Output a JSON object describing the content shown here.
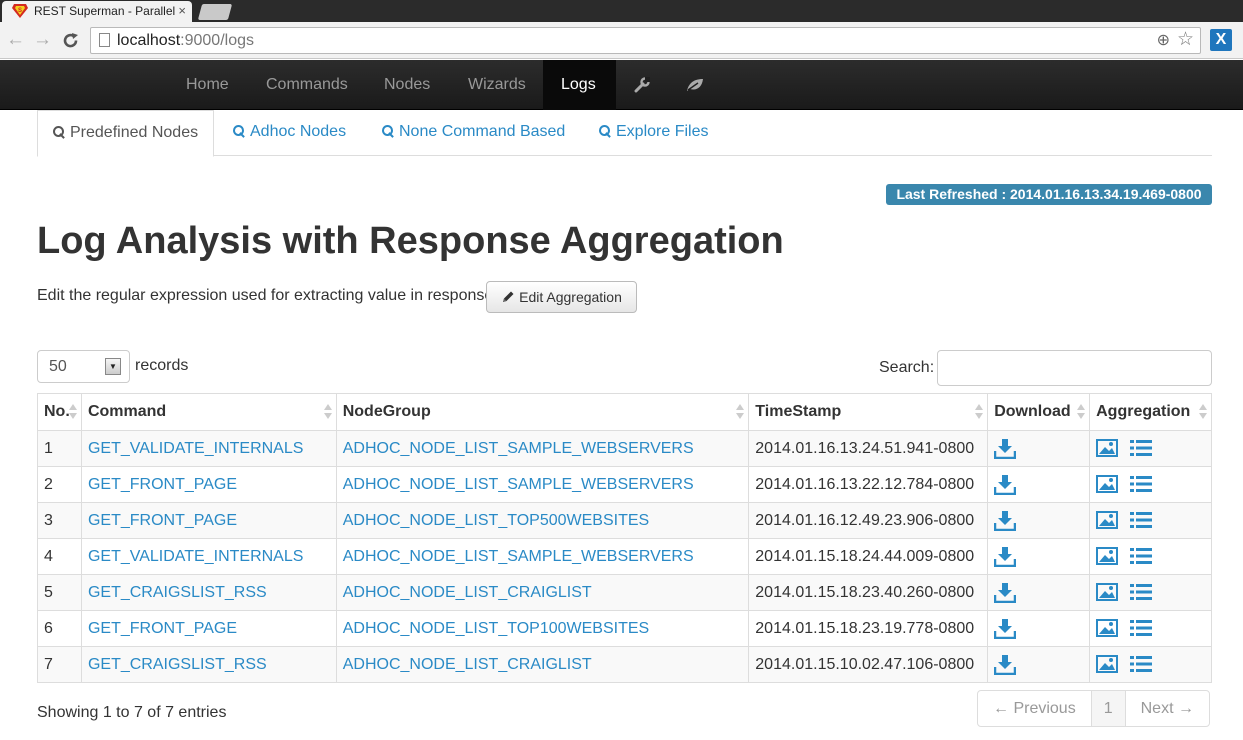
{
  "browser": {
    "tab_title": "REST Superman - Parallel",
    "tab_close": "×",
    "url_host": "localhost",
    "url_path": ":9000/logs",
    "back_glyph": "←",
    "forward_glyph": "→",
    "reload_glyph": "C",
    "zoom_glyph": "⊕",
    "star_glyph": "☆",
    "extension_label": "X"
  },
  "navbar": {
    "items": [
      {
        "label": "Home"
      },
      {
        "label": "Commands"
      },
      {
        "label": "Nodes"
      },
      {
        "label": "Wizards"
      },
      {
        "label": "Logs",
        "active": true
      }
    ],
    "icons": [
      "wrench-icon",
      "leaf-icon"
    ]
  },
  "subtabs": [
    {
      "label": "Predefined Nodes",
      "active": true
    },
    {
      "label": "Adhoc Nodes"
    },
    {
      "label": "None Command Based"
    },
    {
      "label": "Explore Files"
    }
  ],
  "last_refreshed": "Last Refreshed : 2014.01.16.13.34.19.469-0800",
  "page_title": "Log Analysis with Response Aggregation",
  "edit_text": "Edit the regular expression used for extracting value in response:",
  "edit_button_label": "Edit Aggregation",
  "table_controls": {
    "page_length": "50",
    "records_label": "records",
    "search_label": "Search:",
    "search_value": ""
  },
  "table": {
    "columns": [
      "No.",
      "Command",
      "NodeGroup",
      "TimeStamp",
      "Download",
      "Aggregation"
    ],
    "rows": [
      {
        "no": "1",
        "command": "GET_VALIDATE_INTERNALS",
        "nodegroup": "ADHOC_NODE_LIST_SAMPLE_WEBSERVERS",
        "timestamp": "2014.01.16.13.24.51.941-0800"
      },
      {
        "no": "2",
        "command": "GET_FRONT_PAGE",
        "nodegroup": "ADHOC_NODE_LIST_SAMPLE_WEBSERVERS",
        "timestamp": "2014.01.16.13.22.12.784-0800"
      },
      {
        "no": "3",
        "command": "GET_FRONT_PAGE",
        "nodegroup": "ADHOC_NODE_LIST_TOP500WEBSITES",
        "timestamp": "2014.01.16.12.49.23.906-0800"
      },
      {
        "no": "4",
        "command": "GET_VALIDATE_INTERNALS",
        "nodegroup": "ADHOC_NODE_LIST_SAMPLE_WEBSERVERS",
        "timestamp": "2014.01.15.18.24.44.009-0800"
      },
      {
        "no": "5",
        "command": "GET_CRAIGSLIST_RSS",
        "nodegroup": "ADHOC_NODE_LIST_CRAIGLIST",
        "timestamp": "2014.01.15.18.23.40.260-0800"
      },
      {
        "no": "6",
        "command": "GET_FRONT_PAGE",
        "nodegroup": "ADHOC_NODE_LIST_TOP100WEBSITES",
        "timestamp": "2014.01.15.18.23.19.778-0800"
      },
      {
        "no": "7",
        "command": "GET_CRAIGSLIST_RSS",
        "nodegroup": "ADHOC_NODE_LIST_CRAIGLIST",
        "timestamp": "2014.01.15.10.02.47.106-0800"
      }
    ]
  },
  "footer": {
    "info": "Showing 1 to 7 of 7 entries",
    "prev": "← Previous",
    "page": "1",
    "next": "Next →"
  },
  "colors": {
    "link": "#2a8ac6",
    "badge": "#3a87ad",
    "navbar": "#1b1b1b"
  }
}
